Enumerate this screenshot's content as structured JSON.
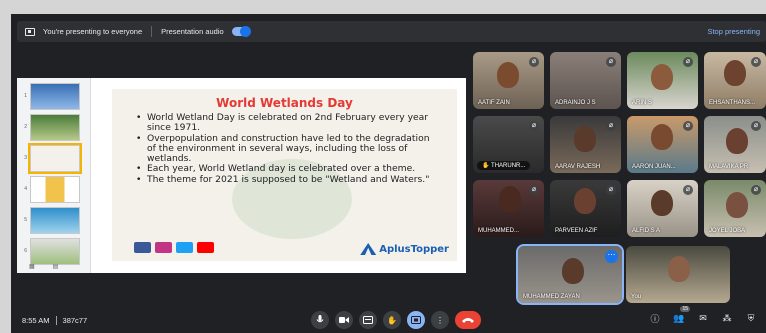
{
  "present_bar": {
    "status_text": "You're presenting to everyone",
    "audio_label": "Presentation audio",
    "stop_label": "Stop presenting"
  },
  "slide": {
    "title": "World Wetlands Day",
    "bullets": [
      "World Wetland Day is celebrated on 2nd February every year since 1971.",
      "Overpopulation and construction have led to the degradation of the environment in several ways, including the loss of wetlands.",
      "Each year, World Wetland day is celebrated over a theme.",
      "The theme for 2021 is supposed to be \"Wetland and Waters.\""
    ],
    "logo_text": "AplusTopper",
    "thumb_numbers": [
      "1",
      "2",
      "3",
      "4",
      "5",
      "6"
    ]
  },
  "participants": [
    {
      "name": "AATIF ZAIN"
    },
    {
      "name": "ADRAINJO J S"
    },
    {
      "name": "ARIN S"
    },
    {
      "name": "EHSANTHANS..."
    },
    {
      "name": "THARUNR..."
    },
    {
      "name": "AARAV RAJESH"
    },
    {
      "name": "AARON JUAN..."
    },
    {
      "name": "MALAVIKA PR"
    },
    {
      "name": "MUHAMMED..."
    },
    {
      "name": "PARVEEN AZIF"
    },
    {
      "name": "ALFID S A"
    },
    {
      "name": "JOYEL JOBA"
    },
    {
      "name": "MUHAMMED ZAYAN"
    },
    {
      "name": "You"
    }
  ],
  "bottom": {
    "time": "8:55 AM",
    "meeting_code": "387c77",
    "people_count": "15"
  },
  "colors": {
    "accent": "#8ab4f8",
    "end_call": "#ea4335",
    "title_red": "#e53935"
  }
}
